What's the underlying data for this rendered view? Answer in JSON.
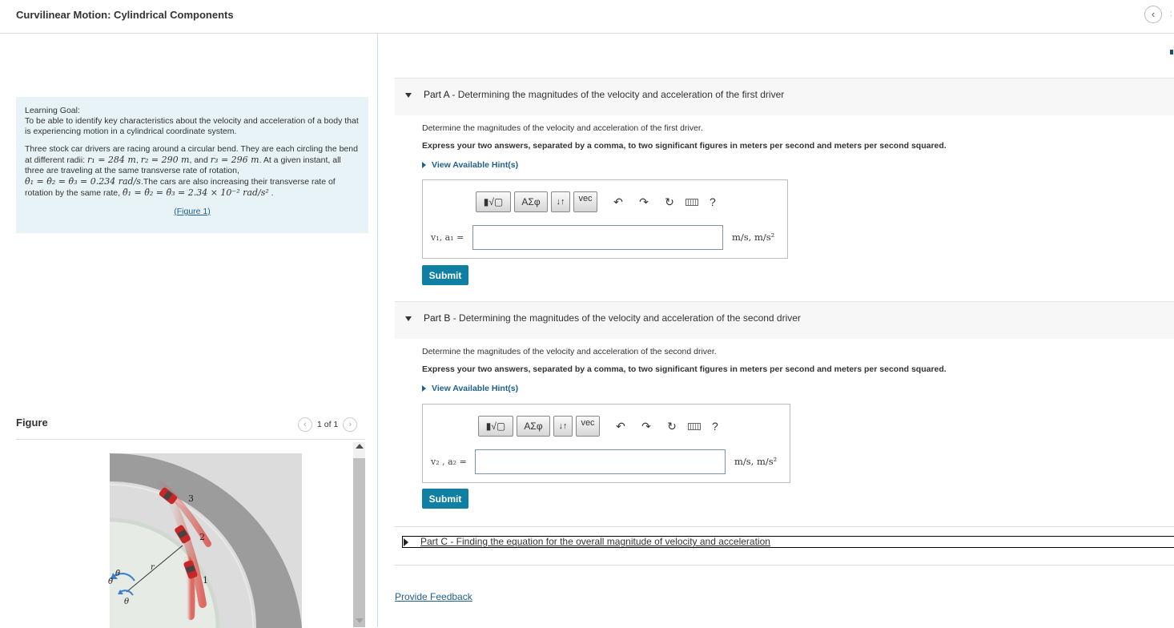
{
  "header": {
    "title": "Curvilinear Motion: Cylindrical Components",
    "back_icon": "chevron-left-icon"
  },
  "intro": {
    "goal_title": "Learning Goal:",
    "goal_text": "To be able to identify key characteristics about the velocity and acceleration of a body that is experiencing motion in a cylindrical coordinate system.",
    "p1": "Three stock car drivers are racing around a circular bend. They are each circling the bend at different radii:",
    "r1": "r₁ = 284 m",
    "r2": "r₂ = 290 m",
    "r3": "r₃ = 296 m",
    "p1b": ". At a given instant, all three are traveling at the same transverse rate of rotation,",
    "theta_dot": "θ̇₁ = θ̇₂ = θ̇₃ = 0.234 rad/s",
    "p2": ".The cars are also increasing their transverse rate of rotation by the same rate,",
    "theta_ddot": "θ̈₁ = θ̈₂ = θ̈₃ = 2.34 × 10⁻² rad/s²",
    "figure_link": "(Figure 1)"
  },
  "figure": {
    "label": "Figure",
    "pager": "1 of 1",
    "car_labels": [
      "3",
      "2",
      "1"
    ],
    "r_label": "r",
    "theta_label": "θ",
    "thetadot_label": "θ̇",
    "thetaddot_label": "θ̈"
  },
  "parts": {
    "a": {
      "letter": "Part A",
      "title": " - Determining the magnitudes of the velocity and acceleration of the first driver",
      "question": "Determine the magnitudes of the velocity and acceleration of the first driver.",
      "instruction": "Express your two answers, separated by a comma, to two significant figures in meters per second and meters per second squared.",
      "hint": "View Available Hint(s)",
      "var_label": "v₁, a₁ =",
      "input_value": "",
      "units": "m/s, m/s²",
      "submit": "Submit"
    },
    "b": {
      "letter": "Part B",
      "title": " - Determining the magnitudes of the velocity and acceleration of the second driver",
      "question": "Determine the magnitudes of the velocity and acceleration of the second driver.",
      "instruction": "Express your two answers, separated by a comma, to two significant figures in meters per second and meters per second squared.",
      "hint": "View Available Hint(s)",
      "var_label": "v₂ , a₂ =",
      "input_value": "",
      "units": "m/s, m/s²",
      "submit": "Submit"
    },
    "c": {
      "letter": "Part C",
      "title": " - Finding the equation for the overall magnitude of velocity and acceleration"
    }
  },
  "toolbar": {
    "template_btn": "▮√▢",
    "greek_btn": "ΑΣφ",
    "arrows_btn": "↓↑",
    "vec_btn": "vec",
    "undo_icon": "undo-icon",
    "redo_icon": "redo-icon",
    "reset_icon": "reset-icon",
    "keyboard_icon": "keyboard-icon",
    "help": "?"
  },
  "feedback": "Provide Feedback",
  "colors": {
    "accent": "#0f7fa3",
    "link": "#1e5f8b",
    "intro_bg": "#e7f3f6"
  }
}
